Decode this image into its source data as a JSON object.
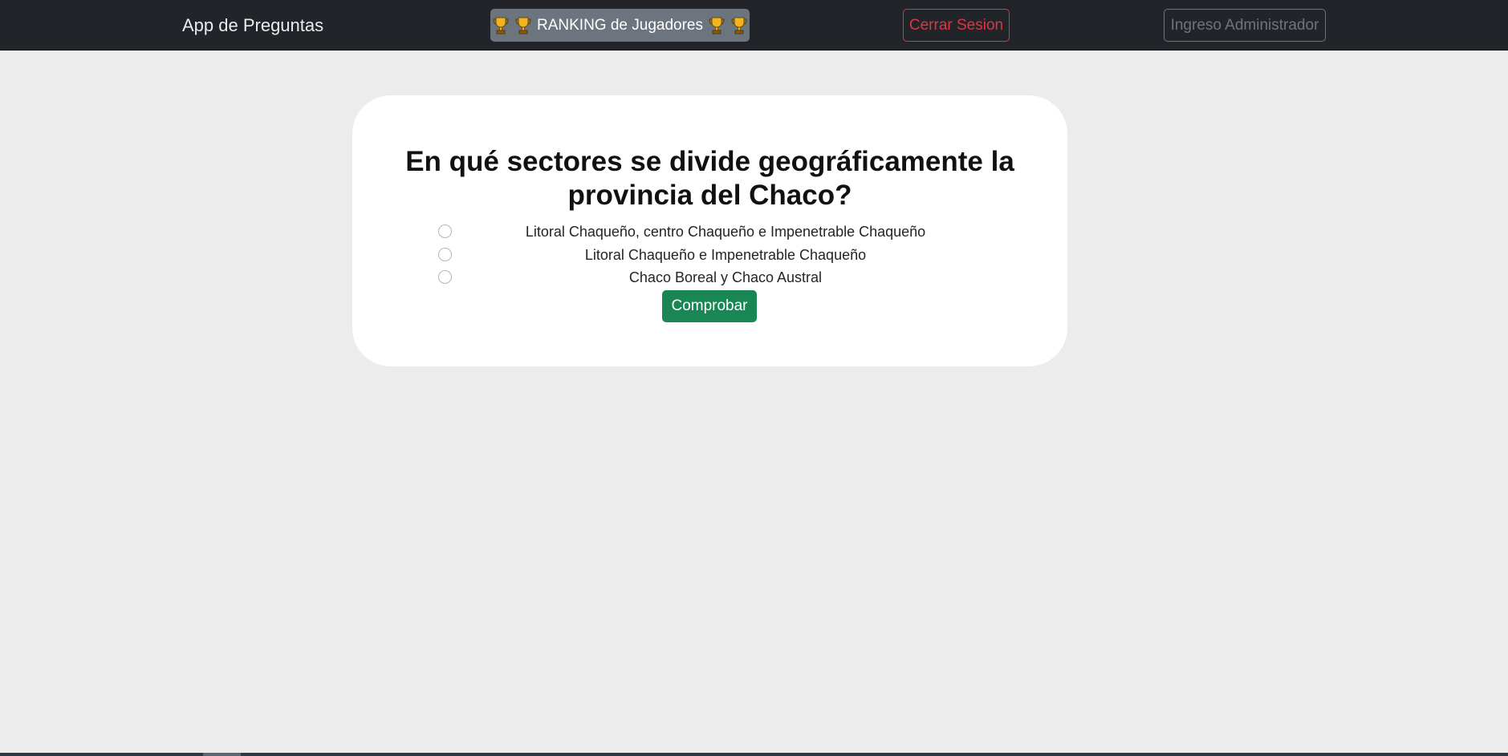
{
  "navbar": {
    "brand": "App de Preguntas",
    "ranking_label": "RANKING de Jugadores",
    "ranking_icon": "trophy-icon",
    "logout_label": "Cerrar Sesion",
    "admin_label": "Ingreso Administrador"
  },
  "quiz": {
    "question": "En qué sectores se divide geográficamente la provincia del Chaco?",
    "options": [
      {
        "label": "Litoral Chaqueño, centro Chaqueño e Impenetrable Chaqueño",
        "checked": false
      },
      {
        "label": "Litoral Chaqueño e Impenetrable Chaqueño",
        "checked": false
      },
      {
        "label": "Chaco Boreal y Chaco Austral",
        "checked": false
      }
    ],
    "submit_label": "Comprobar"
  },
  "colors": {
    "navbar_bg": "#212529",
    "page_bg": "#ececec",
    "ranking_bg": "#6c757d",
    "danger": "#dc3545",
    "secondary": "#6c757d",
    "success": "#198754"
  }
}
